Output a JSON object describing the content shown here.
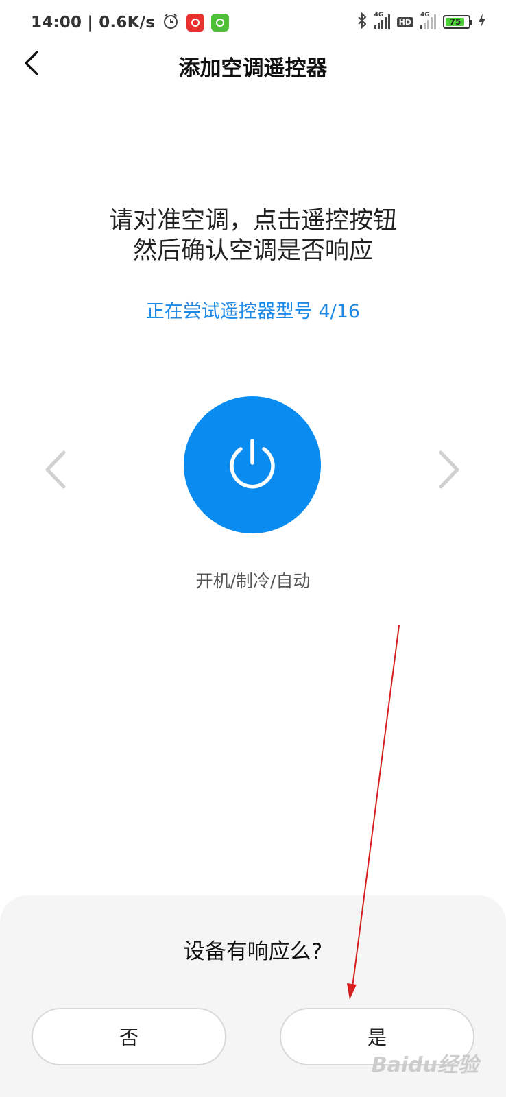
{
  "status_bar": {
    "time_speed": "14:00 | 0.6K/s",
    "signal1_tag": "4G",
    "hd_tag": "HD",
    "signal2_tag": "4G",
    "battery": "75"
  },
  "header": {
    "title": "添加空调遥控器"
  },
  "main": {
    "instruction_line1": "请对准空调，点击遥控按钮",
    "instruction_line2": "然后确认空调是否响应",
    "progress": "正在尝试遥控器型号 4/16",
    "mode_label": "开机/制冷/自动"
  },
  "dialog": {
    "question": "设备有响应么?",
    "no_label": "否",
    "yes_label": "是"
  },
  "colors": {
    "accent": "#0a8bf0",
    "progress_text": "#1e88e5",
    "annotation": "#d62020"
  },
  "watermark": "Baidu经验"
}
